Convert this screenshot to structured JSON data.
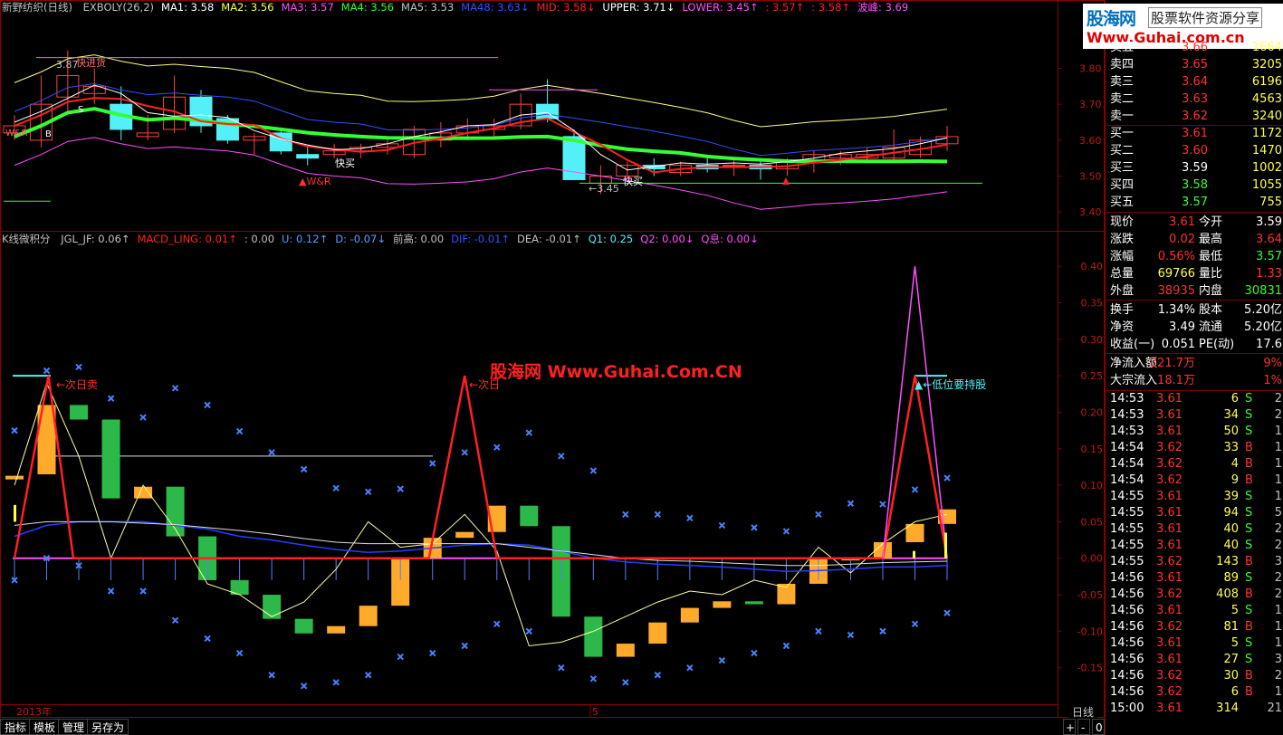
{
  "colors": {
    "bg": "#000000",
    "grid": "#8b0000",
    "axis_text": "#c01818",
    "up": "#ffaa2a",
    "down": "#2db84a",
    "cyan": "#54f0f8",
    "red": "#ff2020",
    "green": "#33ff33",
    "magenta": "#ff50ff",
    "yellow": "#ffff50",
    "blue": "#3050ff",
    "white": "#ffffff"
  },
  "header_top": {
    "title": "新野纺织(日线)",
    "items": [
      {
        "label": "EXBOLY(26,2)",
        "color": "#c0c0c0"
      },
      {
        "label": "MA1: 3.58",
        "color": "#ffffff"
      },
      {
        "label": "MA2: 3.56",
        "color": "#ffff50"
      },
      {
        "label": "MA3: 3.57",
        "color": "#ff50ff"
      },
      {
        "label": "MA4: 3.56",
        "color": "#33ff33"
      },
      {
        "label": "MA5: 3.53",
        "color": "#c0c0c0"
      },
      {
        "label": "MA48: 3.63↓",
        "color": "#3050ff"
      },
      {
        "label": "MID: 3.58↓",
        "color": "#ff2020"
      },
      {
        "label": "UPPER: 3.71↓",
        "color": "#ffffff"
      },
      {
        "label": "LOWER: 3.45↑",
        "color": "#ff50ff"
      },
      {
        "label": ": 3.57↑",
        "color": "#ff2020"
      },
      {
        "label": ": 3.58↑",
        "color": "#ff2020"
      },
      {
        "label": "波峰: 3.69",
        "color": "#ff50ff"
      }
    ]
  },
  "header_bottom": {
    "title": "K线微积分",
    "items": [
      {
        "label": "JGL_JF: 0.06↑",
        "color": "#c0c0c0"
      },
      {
        "label": "MACD_LING: 0.01↑",
        "color": "#ff2020"
      },
      {
        "label": ": 0.00",
        "color": "#c0c0c0"
      },
      {
        "label": "U: 0.12↑",
        "color": "#54a0ff"
      },
      {
        "label": "D: -0.07↓",
        "color": "#54a0ff"
      },
      {
        "label": "前高: 0.00",
        "color": "#c0c0c0"
      },
      {
        "label": "DIF: -0.01↑",
        "color": "#3050ff"
      },
      {
        "label": "DEA: -0.01↑",
        "color": "#c0c0c0"
      },
      {
        "label": "Q1: 0.25",
        "color": "#54f0f8"
      },
      {
        "label": "Q2: 0.00↓",
        "color": "#ff50ff"
      },
      {
        "label": "Q息: 0.00↓",
        "color": "#ff50ff"
      }
    ]
  },
  "annotations": {
    "top_buy_top": "3.87",
    "top_buy_label": "快进货",
    "wr_label_1": "W&R",
    "wr_label_2": "▲W&R",
    "s_label": "S",
    "b_label": "B",
    "quick_buy_1": "快买",
    "quick_buy_2": "快买",
    "low_label": "←3.45",
    "next_day_sell": "←次日卖",
    "next_day_sell_2": "←次日",
    "low_hold": "▲←低位要持股",
    "watermark": "股海网 Www.Guhai.Com.CN",
    "year": "2013年",
    "month": "5"
  },
  "top_axis": {
    "min": 3.35,
    "max": 3.95,
    "ticks": [
      "3.80",
      "3.70",
      "3.60",
      "3.50",
      "3.40"
    ],
    "tick_values": [
      3.8,
      3.7,
      3.6,
      3.5,
      3.4
    ]
  },
  "bottom_axis": {
    "min": -0.2,
    "max": 0.43,
    "ticks": [
      "0.40",
      "0.35",
      "0.30",
      "0.25",
      "0.20",
      "0.15",
      "0.10",
      "0.05",
      "0.00",
      "-0.05",
      "-0.10",
      "-0.15"
    ],
    "tick_values": [
      0.4,
      0.35,
      0.3,
      0.25,
      0.2,
      0.15,
      0.1,
      0.05,
      0.0,
      -0.05,
      -0.1,
      -0.15
    ]
  },
  "chart_data": [
    {
      "type": "candlestick",
      "title": "新野纺织(日线)",
      "ylim": [
        3.35,
        3.95
      ],
      "candles": [
        {
          "o": 3.62,
          "h": 3.67,
          "l": 3.6,
          "c": 3.64
        },
        {
          "o": 3.6,
          "h": 3.78,
          "l": 3.58,
          "c": 3.7
        },
        {
          "o": 3.72,
          "h": 3.85,
          "l": 3.68,
          "c": 3.78
        },
        {
          "o": 3.73,
          "h": 3.8,
          "l": 3.7,
          "c": 3.75
        },
        {
          "o": 3.7,
          "h": 3.75,
          "l": 3.6,
          "c": 3.63
        },
        {
          "o": 3.61,
          "h": 3.67,
          "l": 3.6,
          "c": 3.62
        },
        {
          "o": 3.63,
          "h": 3.78,
          "l": 3.62,
          "c": 3.72
        },
        {
          "o": 3.72,
          "h": 3.74,
          "l": 3.62,
          "c": 3.64
        },
        {
          "o": 3.66,
          "h": 3.67,
          "l": 3.59,
          "c": 3.6
        },
        {
          "o": 3.6,
          "h": 3.62,
          "l": 3.56,
          "c": 3.61
        },
        {
          "o": 3.62,
          "h": 3.63,
          "l": 3.56,
          "c": 3.57
        },
        {
          "o": 3.56,
          "h": 3.58,
          "l": 3.53,
          "c": 3.55
        },
        {
          "o": 3.56,
          "h": 3.59,
          "l": 3.55,
          "c": 3.57
        },
        {
          "o": 3.57,
          "h": 3.59,
          "l": 3.55,
          "c": 3.58
        },
        {
          "o": 3.58,
          "h": 3.61,
          "l": 3.56,
          "c": 3.59
        },
        {
          "o": 3.56,
          "h": 3.64,
          "l": 3.55,
          "c": 3.63
        },
        {
          "o": 3.6,
          "h": 3.65,
          "l": 3.58,
          "c": 3.62
        },
        {
          "o": 3.62,
          "h": 3.66,
          "l": 3.6,
          "c": 3.64
        },
        {
          "o": 3.63,
          "h": 3.66,
          "l": 3.61,
          "c": 3.64
        },
        {
          "o": 3.64,
          "h": 3.73,
          "l": 3.63,
          "c": 3.7
        },
        {
          "o": 3.7,
          "h": 3.77,
          "l": 3.65,
          "c": 3.66
        },
        {
          "o": 3.61,
          "h": 3.63,
          "l": 3.52,
          "c": 3.49
        },
        {
          "o": 3.48,
          "h": 3.53,
          "l": 3.45,
          "c": 3.5
        },
        {
          "o": 3.5,
          "h": 3.54,
          "l": 3.49,
          "c": 3.53
        },
        {
          "o": 3.53,
          "h": 3.55,
          "l": 3.5,
          "c": 3.52
        },
        {
          "o": 3.51,
          "h": 3.54,
          "l": 3.5,
          "c": 3.53
        },
        {
          "o": 3.53,
          "h": 3.55,
          "l": 3.51,
          "c": 3.52
        },
        {
          "o": 3.53,
          "h": 3.55,
          "l": 3.5,
          "c": 3.53
        },
        {
          "o": 3.53,
          "h": 3.55,
          "l": 3.49,
          "c": 3.52
        },
        {
          "o": 3.52,
          "h": 3.55,
          "l": 3.5,
          "c": 3.54
        },
        {
          "o": 3.54,
          "h": 3.57,
          "l": 3.51,
          "c": 3.56
        },
        {
          "o": 3.55,
          "h": 3.57,
          "l": 3.53,
          "c": 3.56
        },
        {
          "o": 3.55,
          "h": 3.58,
          "l": 3.54,
          "c": 3.56
        },
        {
          "o": 3.55,
          "h": 3.63,
          "l": 3.54,
          "c": 3.58
        },
        {
          "o": 3.56,
          "h": 3.61,
          "l": 3.55,
          "c": 3.6
        },
        {
          "o": 3.59,
          "h": 3.64,
          "l": 3.57,
          "c": 3.61
        }
      ]
    },
    {
      "type": "bar",
      "title": "K线微积分",
      "ylim": [
        -0.2,
        0.43
      ],
      "bars": [
        {
          "top": 0.113,
          "bot": 0.108
        },
        {
          "top": 0.21,
          "bot": 0.115
        },
        {
          "top": 0.21,
          "bot": 0.19
        },
        {
          "top": 0.19,
          "bot": 0.082
        },
        {
          "top": 0.098,
          "bot": 0.082
        },
        {
          "top": 0.098,
          "bot": 0.03
        },
        {
          "top": 0.03,
          "bot": -0.03
        },
        {
          "top": -0.03,
          "bot": -0.05
        },
        {
          "top": -0.05,
          "bot": -0.083
        },
        {
          "top": -0.083,
          "bot": -0.103
        },
        {
          "top": -0.093,
          "bot": -0.103
        },
        {
          "top": -0.065,
          "bot": -0.093
        },
        {
          "top": 0.0,
          "bot": -0.065
        },
        {
          "top": 0.028,
          "bot": 0.0
        },
        {
          "top": 0.036,
          "bot": 0.028
        },
        {
          "top": 0.072,
          "bot": 0.036
        },
        {
          "top": 0.072,
          "bot": 0.044
        },
        {
          "top": 0.044,
          "bot": -0.08
        },
        {
          "top": -0.08,
          "bot": -0.135
        },
        {
          "top": -0.117,
          "bot": -0.135
        },
        {
          "top": -0.088,
          "bot": -0.117
        },
        {
          "top": -0.068,
          "bot": -0.088
        },
        {
          "top": -0.059,
          "bot": -0.068
        },
        {
          "top": -0.059,
          "bot": -0.063
        },
        {
          "top": -0.035,
          "bot": -0.063
        },
        {
          "top": 0.0,
          "bot": -0.035
        },
        {
          "top": 0.0,
          "bot": -0.003
        },
        {
          "top": 0.022,
          "bot": 0.0
        },
        {
          "top": 0.047,
          "bot": 0.022
        },
        {
          "top": 0.067,
          "bot": 0.047
        }
      ],
      "bar_dir": [
        "u",
        "u",
        "d",
        "d",
        "u",
        "d",
        "d",
        "d",
        "d",
        "d",
        "u",
        "u",
        "u",
        "u",
        "u",
        "u",
        "d",
        "d",
        "d",
        "u",
        "u",
        "u",
        "u",
        "d",
        "u",
        "u",
        "u",
        "u",
        "u",
        "u"
      ]
    }
  ],
  "quote": {
    "rows": [
      {
        "label": "卖五",
        "price": "3.66",
        "vol": "1664",
        "pc": "#ff3030"
      },
      {
        "label": "卖四",
        "price": "3.65",
        "vol": "3205",
        "pc": "#ff3030"
      },
      {
        "label": "卖三",
        "price": "3.64",
        "vol": "6196",
        "pc": "#ff3030"
      },
      {
        "label": "卖二",
        "price": "3.63",
        "vol": "4563",
        "pc": "#ff3030"
      },
      {
        "label": "卖一",
        "price": "3.62",
        "vol": "3240",
        "pc": "#ff3030"
      },
      {
        "label": "买一",
        "price": "3.61",
        "vol": "1172",
        "pc": "#ff3030"
      },
      {
        "label": "买二",
        "price": "3.60",
        "vol": "1470",
        "pc": "#ff3030"
      },
      {
        "label": "买三",
        "price": "3.59",
        "vol": "1002",
        "pc": "#ffffff"
      },
      {
        "label": "买四",
        "price": "3.58",
        "vol": "1055",
        "pc": "#33ff33"
      },
      {
        "label": "买五",
        "price": "3.57",
        "vol": "755",
        "pc": "#33ff33"
      }
    ],
    "stats": [
      {
        "l1": "现价",
        "v1": "3.61",
        "c1": "#ff3030",
        "l2": "今开",
        "v2": "3.59",
        "c2": "#ffffff"
      },
      {
        "l1": "涨跌",
        "v1": "0.02",
        "c1": "#ff3030",
        "l2": "最高",
        "v2": "3.64",
        "c2": "#ff3030"
      },
      {
        "l1": "涨幅",
        "v1": "0.56%",
        "c1": "#ff3030",
        "l2": "最低",
        "v2": "3.57",
        "c2": "#33ff33"
      },
      {
        "l1": "总量",
        "v1": "69766",
        "c1": "#ffff50",
        "l2": "量比",
        "v2": "1.33",
        "c2": "#ff3030"
      },
      {
        "l1": "外盘",
        "v1": "38935",
        "c1": "#ff3030",
        "l2": "内盘",
        "v2": "30831",
        "c2": "#33ff33"
      },
      {
        "l1": "换手",
        "v1": "1.34%",
        "c1": "#ffffff",
        "l2": "股本",
        "v2": "5.20亿",
        "c2": "#ffffff"
      },
      {
        "l1": "净资",
        "v1": "3.49",
        "c1": "#ffffff",
        "l2": "流通",
        "v2": "5.20亿",
        "c2": "#ffffff"
      },
      {
        "l1": "收益(一)",
        "v1": "0.051",
        "c1": "#ffffff",
        "l2": "PE(动)",
        "v2": "17.6",
        "c2": "#ffffff"
      },
      {
        "l1": "净流入额",
        "v1": "221.7万",
        "c1": "#ff3030",
        "l2": "",
        "v2": "9%",
        "c2": "#ff3030"
      },
      {
        "l1": "大宗流入",
        "v1": "18.1万",
        "c1": "#ff3030",
        "l2": "",
        "v2": "1%",
        "c2": "#ff3030"
      }
    ],
    "ticks": [
      {
        "t": "14:53",
        "p": "3.61",
        "v": "6",
        "s": "S",
        "n": "2"
      },
      {
        "t": "14:53",
        "p": "3.61",
        "v": "34",
        "s": "S",
        "n": "2"
      },
      {
        "t": "14:53",
        "p": "3.61",
        "v": "50",
        "s": "S",
        "n": "1"
      },
      {
        "t": "14:54",
        "p": "3.62",
        "v": "33",
        "s": "B",
        "n": "1"
      },
      {
        "t": "14:54",
        "p": "3.62",
        "v": "4",
        "s": "B",
        "n": "1"
      },
      {
        "t": "14:54",
        "p": "3.62",
        "v": "9",
        "s": "B",
        "n": "1"
      },
      {
        "t": "14:55",
        "p": "3.61",
        "v": "39",
        "s": "S",
        "n": "1"
      },
      {
        "t": "14:55",
        "p": "3.61",
        "v": "94",
        "s": "S",
        "n": "5"
      },
      {
        "t": "14:55",
        "p": "3.61",
        "v": "40",
        "s": "S",
        "n": "2"
      },
      {
        "t": "14:55",
        "p": "3.61",
        "v": "40",
        "s": "S",
        "n": "2"
      },
      {
        "t": "14:55",
        "p": "3.62",
        "v": "143",
        "s": "B",
        "n": "3"
      },
      {
        "t": "14:56",
        "p": "3.61",
        "v": "89",
        "s": "S",
        "n": "2"
      },
      {
        "t": "14:56",
        "p": "3.62",
        "v": "408",
        "s": "B",
        "n": "2"
      },
      {
        "t": "14:56",
        "p": "3.61",
        "v": "5",
        "s": "S",
        "n": "1"
      },
      {
        "t": "14:56",
        "p": "3.62",
        "v": "81",
        "s": "B",
        "n": "1"
      },
      {
        "t": "14:56",
        "p": "3.61",
        "v": "5",
        "s": "S",
        "n": "1"
      },
      {
        "t": "14:56",
        "p": "3.61",
        "v": "27",
        "s": "S",
        "n": "3"
      },
      {
        "t": "14:56",
        "p": "3.62",
        "v": "30",
        "s": "B",
        "n": "2"
      },
      {
        "t": "14:56",
        "p": "3.62",
        "v": "6",
        "s": "B",
        "n": "1"
      },
      {
        "t": "15:00",
        "p": "3.61",
        "v": "314",
        "s": "",
        "n": "21"
      }
    ]
  },
  "logo": {
    "line1": "股海网",
    "line2": "股票软件资源分享",
    "line3": "Www.Guhai.com.cn"
  },
  "tabs": [
    {
      "label": "指标"
    },
    {
      "label": "模板"
    },
    {
      "label": "管理"
    },
    {
      "label": "另存为"
    }
  ],
  "right_bottom": {
    "period": "日线",
    "plus": "+",
    "minus": "-",
    "zero": "0"
  }
}
